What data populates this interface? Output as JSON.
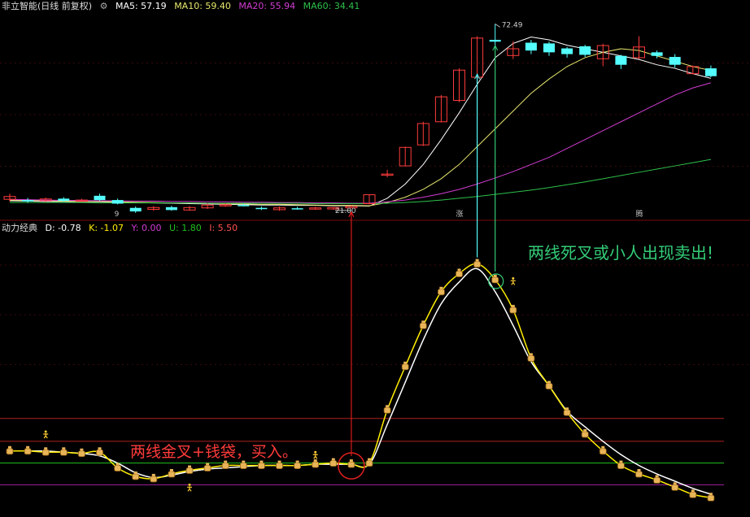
{
  "main_header": {
    "title": "非立智能(日线 前复权)",
    "ma5": "MA5: 57.19",
    "ma10": "MA10: 59.40",
    "ma20": "MA20: 55.94",
    "ma60": "MA60: 34.41"
  },
  "sub_header": {
    "title": "动力经典",
    "d": "D: -0.78",
    "k": "K: -1.07",
    "y": "Y: 0.00",
    "u": "U: 1.80",
    "i": "I: 5.50"
  },
  "annotations": {
    "sell": "两线死叉或小人出现卖出!",
    "buy": "两线金叉+钱袋，买入。",
    "high_label": "72.49",
    "low_label": "21.00",
    "date_marks": [
      "9",
      "涨",
      "腾"
    ]
  },
  "colors": {
    "bg": "#000000",
    "up": "#ff3b3b",
    "down": "#54ffff",
    "ma5": "#ffffff",
    "ma10": "#e6e66e",
    "ma20": "#d23cd2",
    "ma60": "#2ec04a",
    "sub_k": "#ffee00",
    "sub_d": "#ffffff",
    "ref_red": "#b02020",
    "ref_green": "#20c020",
    "ref_magenta": "#a020a0",
    "sell_text": "#33cc77",
    "buy_text": "#ff3b3b"
  },
  "chart_data": [
    {
      "type": "candlestick",
      "title": "非立智能(日线 前复权)",
      "series": [
        {
          "name": "MA5",
          "values": [
            22.8,
            22.7,
            22.6,
            22.6,
            22.5,
            22.5,
            22.4,
            22.3,
            22.2,
            22.1,
            22.0,
            21.9,
            21.8,
            21.7,
            21.6,
            21.6,
            21.5,
            21.5,
            21.4,
            21.4,
            21.3,
            23.5,
            27.5,
            33.0,
            40.0,
            47.5,
            55.5,
            63.0,
            67.0,
            68.8,
            68.0,
            66.5,
            65.5,
            64.5,
            63.5,
            62.5,
            61.0,
            60.0,
            58.5,
            57.19
          ]
        },
        {
          "name": "MA10",
          "values": [
            23.0,
            22.9,
            22.8,
            22.7,
            22.6,
            22.6,
            22.5,
            22.4,
            22.3,
            22.2,
            22.2,
            22.1,
            22.0,
            21.9,
            21.8,
            21.8,
            21.7,
            21.6,
            21.5,
            21.5,
            21.4,
            22.3,
            23.8,
            26.0,
            29.0,
            33.0,
            38.0,
            43.0,
            48.0,
            53.0,
            57.0,
            60.5,
            63.0,
            64.5,
            65.5,
            65.0,
            63.5,
            62.0,
            60.5,
            59.4
          ]
        },
        {
          "name": "MA20",
          "values": [
            23.2,
            23.1,
            23.0,
            22.9,
            22.9,
            22.8,
            22.8,
            22.7,
            22.7,
            22.6,
            22.6,
            22.5,
            22.5,
            22.4,
            22.4,
            22.3,
            22.3,
            22.2,
            22.2,
            22.1,
            22.1,
            22.5,
            23.0,
            23.8,
            24.8,
            26.0,
            27.5,
            29.2,
            31.0,
            33.0,
            35.0,
            37.5,
            40.0,
            42.5,
            45.0,
            47.5,
            50.0,
            52.5,
            54.5,
            55.94
          ]
        },
        {
          "name": "MA60",
          "values": [
            22.3,
            22.3,
            22.3,
            22.3,
            22.3,
            22.2,
            22.2,
            22.2,
            22.2,
            22.2,
            22.2,
            22.1,
            22.1,
            22.1,
            22.1,
            22.1,
            22.1,
            22.0,
            22.0,
            22.0,
            22.0,
            22.1,
            22.3,
            22.6,
            23.0,
            23.5,
            24.0,
            24.6,
            25.2,
            25.8,
            26.5,
            27.3,
            28.1,
            29.0,
            29.9,
            30.8,
            31.7,
            32.6,
            33.5,
            34.41
          ]
        }
      ],
      "candles": [
        {
          "o": 23.2,
          "c": 24.0,
          "h": 24.8,
          "l": 22.6
        },
        {
          "o": 23.0,
          "c": 22.6,
          "h": 23.6,
          "l": 22.2
        },
        {
          "o": 22.8,
          "c": 23.3,
          "h": 23.7,
          "l": 22.5
        },
        {
          "o": 23.4,
          "c": 22.8,
          "h": 23.8,
          "l": 22.5
        },
        {
          "o": 22.9,
          "c": 23.0,
          "h": 23.4,
          "l": 22.6
        },
        {
          "o": 24.2,
          "c": 23.0,
          "h": 24.8,
          "l": 22.8
        },
        {
          "o": 23.0,
          "c": 22.0,
          "h": 23.4,
          "l": 21.8
        },
        {
          "o": 20.8,
          "c": 19.8,
          "h": 21.2,
          "l": 19.4
        },
        {
          "o": 20.4,
          "c": 20.9,
          "h": 21.3,
          "l": 20.0
        },
        {
          "o": 21.0,
          "c": 20.2,
          "h": 21.4,
          "l": 20.0
        },
        {
          "o": 20.2,
          "c": 20.9,
          "h": 21.3,
          "l": 20.0
        },
        {
          "o": 20.8,
          "c": 21.6,
          "h": 22.0,
          "l": 20.5
        },
        {
          "o": 21.4,
          "c": 21.7,
          "h": 22.0,
          "l": 21.1
        },
        {
          "o": 21.6,
          "c": 21.5,
          "h": 22.0,
          "l": 21.2
        },
        {
          "o": 20.8,
          "c": 20.5,
          "h": 21.2,
          "l": 20.2
        },
        {
          "o": 20.3,
          "c": 20.8,
          "h": 21.2,
          "l": 20.0
        },
        {
          "o": 20.7,
          "c": 20.6,
          "h": 21.1,
          "l": 20.3
        },
        {
          "o": 20.6,
          "c": 20.8,
          "h": 21.1,
          "l": 20.3
        },
        {
          "o": 20.5,
          "c": 20.9,
          "h": 21.0,
          "l": 20.3
        },
        {
          "o": 20.8,
          "c": 21.2,
          "h": 21.5,
          "l": 21.0
        },
        {
          "o": 22.0,
          "c": 24.5,
          "h": 24.6,
          "l": 21.8
        },
        {
          "o": 30.3,
          "c": 30.3,
          "h": 31.5,
          "l": 29.4
        },
        {
          "o": 32.6,
          "c": 37.8,
          "h": 38.0,
          "l": 32.6
        },
        {
          "o": 38.5,
          "c": 44.5,
          "h": 45.0,
          "l": 38.2
        },
        {
          "o": 45.0,
          "c": 52.0,
          "h": 52.5,
          "l": 44.8
        },
        {
          "o": 51.0,
          "c": 59.5,
          "h": 60.0,
          "l": 50.5
        },
        {
          "o": 57.5,
          "c": 68.5,
          "h": 69.0,
          "l": 57.0
        },
        {
          "o": 68.0,
          "c": 67.5,
          "h": 72.49,
          "l": 65.5
        },
        {
          "o": 63.6,
          "c": 65.5,
          "h": 67.6,
          "l": 62.6
        },
        {
          "o": 67.2,
          "c": 65.0,
          "h": 68.0,
          "l": 64.0
        },
        {
          "o": 67.0,
          "c": 64.5,
          "h": 67.5,
          "l": 63.5
        },
        {
          "o": 65.6,
          "c": 64.0,
          "h": 66.0,
          "l": 63.0
        },
        {
          "o": 66.2,
          "c": 63.8,
          "h": 66.6,
          "l": 63.2
        },
        {
          "o": 62.7,
          "c": 66.4,
          "h": 66.9,
          "l": 60.6
        },
        {
          "o": 63.5,
          "c": 61.0,
          "h": 63.8,
          "l": 59.8
        },
        {
          "o": 63.0,
          "c": 66.0,
          "h": 69.0,
          "l": 62.6
        },
        {
          "o": 64.5,
          "c": 63.5,
          "h": 65.0,
          "l": 62.8
        },
        {
          "o": 63.2,
          "c": 61.0,
          "h": 64.0,
          "l": 60.2
        },
        {
          "o": 58.5,
          "c": 60.5,
          "h": 60.8,
          "l": 58.3
        },
        {
          "o": 60.0,
          "c": 57.8,
          "h": 60.8,
          "l": 57.5
        }
      ],
      "ylim": [
        18,
        76
      ]
    },
    {
      "type": "line",
      "title": "动力经典",
      "series": [
        {
          "name": "K",
          "values": [
            2.8,
            2.8,
            2.7,
            2.7,
            2.6,
            2.7,
            1.4,
            0.7,
            0.5,
            0.9,
            1.2,
            1.4,
            1.6,
            1.6,
            1.6,
            1.6,
            1.6,
            1.7,
            1.8,
            1.7,
            1.8,
            6.2,
            9.8,
            13.2,
            16.0,
            17.5,
            18.3,
            17.0,
            14.5,
            10.5,
            8.2,
            6.0,
            4.2,
            2.8,
            1.6,
            0.9,
            0.4,
            -0.2,
            -0.8,
            -1.07
          ]
        },
        {
          "name": "D",
          "values": [
            2.8,
            2.8,
            2.8,
            2.7,
            2.6,
            2.4,
            1.8,
            1.0,
            0.6,
            0.8,
            1.1,
            1.3,
            1.4,
            1.5,
            1.6,
            1.6,
            1.6,
            1.7,
            1.7,
            1.7,
            1.7,
            5.0,
            8.5,
            12.0,
            15.0,
            16.8,
            17.9,
            16.0,
            13.2,
            10.2,
            8.2,
            6.1,
            4.8,
            3.6,
            2.5,
            1.6,
            0.9,
            0.3,
            -0.3,
            -0.78
          ]
        }
      ],
      "reference_lines": [
        5.5,
        3.6,
        1.8,
        0.0
      ],
      "ylim": [
        -2.4,
        20.5
      ]
    }
  ]
}
